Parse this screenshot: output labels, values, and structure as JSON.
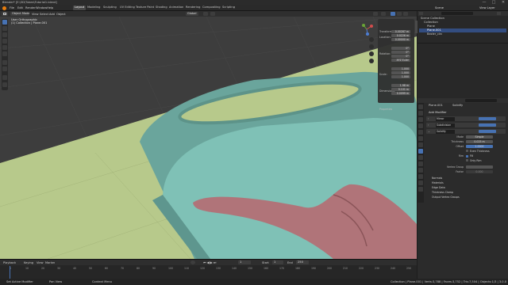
{
  "window": {
    "title": "Blender* [E:\\3D\\Tubes\\Tutorial1.blend]",
    "controls": [
      "—",
      "□",
      "✕"
    ]
  },
  "menubar": {
    "menus": [
      "File",
      "Edit",
      "Render",
      "Window",
      "Help"
    ],
    "workspaces": [
      "Layout",
      "Modeling",
      "Sculpting",
      "UV Editing",
      "Texture Paint",
      "Shading",
      "Animation",
      "Rendering",
      "Compositing",
      "Scripting"
    ],
    "active_workspace": "Layout",
    "scene_label": "Scene",
    "view_layer_label": "View Layer"
  },
  "viewport_header": {
    "mode": "Object Mode",
    "menus": [
      "View",
      "Select",
      "Add",
      "Object"
    ],
    "orientation": "Global"
  },
  "viewport": {
    "view_name": "User Orthographic",
    "collection_path": "(1) Collection | Plane.001"
  },
  "npanel": {
    "section_transform": "Transform",
    "location_label": "Location:",
    "location": [
      "0.00287 m",
      "0.0226 m",
      "0.00000 m"
    ],
    "rotation_label": "Rotation:",
    "rotation": [
      "0°",
      "0°",
      "0°"
    ],
    "mode": "XYZ Euler",
    "scale_label": "Scale:",
    "scale": [
      "1.000",
      "1.000",
      "1.000"
    ],
    "dimensions_label": "Dimensions:",
    "dimensions": [
      "1.98 m",
      "0.101 m",
      "0.0099 m"
    ],
    "section_properties": "Properties",
    "tabs": [
      "Item",
      "Tool",
      "View"
    ]
  },
  "outliner": {
    "header": "Scene Collection",
    "rows": [
      {
        "label": "Scene Collection",
        "selected": false
      },
      {
        "label": "Collection",
        "selected": false
      },
      {
        "label": "Plane",
        "selected": false
      },
      {
        "label": "Plane.001",
        "selected": true
      },
      {
        "label": "Bezier_circ",
        "selected": false
      }
    ]
  },
  "properties": {
    "breadcrumb_object": "Plane.001",
    "breadcrumb_modifier": "Solidify",
    "add_modifier": "Add Modifier",
    "modifiers": [
      "Mirror",
      "Subdivision",
      "Solidify"
    ],
    "fields": [
      {
        "label": "Mode",
        "value": "Simple"
      },
      {
        "label": "Thickness",
        "value": "0.025 m"
      },
      {
        "label": "Offset",
        "value": "1.0000"
      },
      {
        "label": "",
        "value": "Even Thickness"
      },
      {
        "label": "Rim",
        "value": "Fill"
      },
      {
        "label": "",
        "value": "Only Rim"
      },
      {
        "label": "Vertex Group",
        "value": ""
      },
      {
        "label": "Factor",
        "value": "0.000"
      }
    ],
    "subpanels": [
      "Normals",
      "Materials",
      "Edge Data",
      "Thickness Clamp",
      "Output Vertex Groups"
    ]
  },
  "timeline": {
    "menus": [
      "Playback",
      "Keying",
      "View",
      "Marker"
    ],
    "current_frame": "1",
    "start_label": "Start",
    "start": "1",
    "end_label": "End",
    "end": "250",
    "ticks": [
      "0",
      "10",
      "20",
      "30",
      "40",
      "50",
      "60",
      "70",
      "80",
      "90",
      "100",
      "110",
      "120",
      "130",
      "140",
      "150",
      "160",
      "170",
      "180",
      "190",
      "200",
      "210",
      "220",
      "230",
      "240",
      "250"
    ]
  },
  "statusbar": {
    "left": "Set Active Modifier",
    "mid1": "Pan View",
    "mid2": "Context Menu",
    "right": "Collection | Plane.001 | Verts:3,788 | Faces:3,752 | Tris:7,504 | Objects:1/3 | 3.0.0"
  },
  "colors": {
    "accent": "#4772b3",
    "plane_green": "#b7c98b",
    "teal_mesh": "#7bbcb2",
    "pink_mesh": "#b07479",
    "selected_row": "#334d80"
  }
}
